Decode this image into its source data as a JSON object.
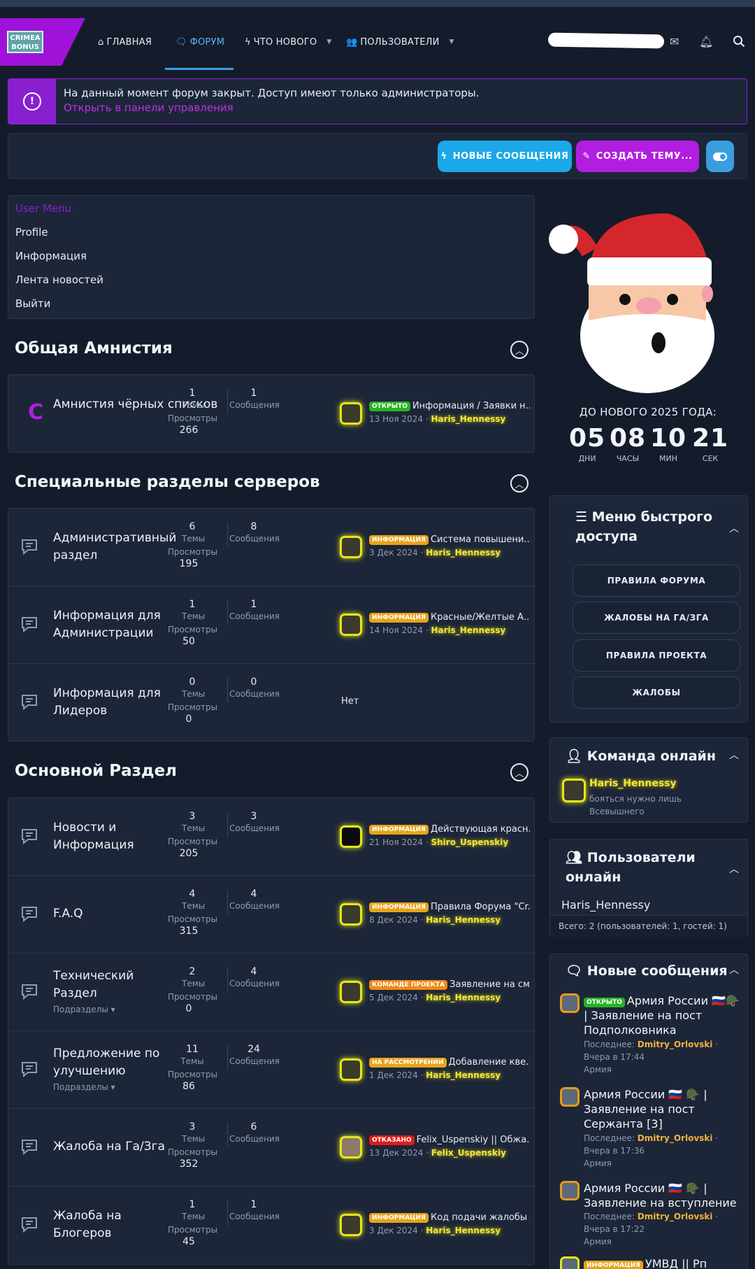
{
  "nav": {
    "logo_text": "CRIMEA BONUS",
    "items": [
      {
        "label": "ГЛАВНАЯ"
      },
      {
        "label": "ФОРУМ"
      },
      {
        "label": "ЧТО НОВОГО"
      },
      {
        "label": "ПОЛЬЗОВАТЕЛИ"
      }
    ]
  },
  "alert": {
    "text": "На данный момент форум закрыт. Доступ имеют только администраторы.",
    "link": "Открыть в панели управления"
  },
  "actions": {
    "new_posts": "НОВЫЕ СООБЩЕНИЯ",
    "create_thread": "СОЗДАТЬ ТЕМУ..."
  },
  "user_menu": {
    "title": "User Menu",
    "items": [
      "Profile",
      "Информация",
      "Лента новостей",
      "Выйти"
    ]
  },
  "labels": {
    "threads": "Темы",
    "messages": "Сообщения",
    "views": "Просмотры",
    "subforums": "Подразделы",
    "none": "Нет"
  },
  "sections": [
    {
      "title": "Общая Амнистия",
      "forums": [
        {
          "name": "Амнистия чёрных списков",
          "threads": "1",
          "messages": "1",
          "views": "266",
          "badge": "ОТКРЫТО",
          "badge_type": "open",
          "last_title": "Информация / Заявки н...",
          "date": "13 Ноя 2024",
          "user": "Haris_Hennessy"
        }
      ]
    },
    {
      "title": "Специальные разделы серверов",
      "forums": [
        {
          "name": "Административный раздел",
          "threads": "6",
          "messages": "8",
          "views": "195",
          "badge": "ИНФОРМАЦИЯ",
          "badge_type": "info",
          "last_title": "Система повышени...",
          "date": "3 Дек 2024",
          "user": "Haris_Hennessy"
        },
        {
          "name": "Информация для Администрации",
          "threads": "1",
          "messages": "1",
          "views": "50",
          "badge": "ИНФОРМАЦИЯ",
          "badge_type": "info",
          "last_title": "Красные/Желтые А...",
          "date": "14 Ноя 2024",
          "user": "Haris_Hennessy"
        },
        {
          "name": "Информация для Лидеров",
          "threads": "0",
          "messages": "0",
          "views": "0",
          "none": true
        }
      ]
    },
    {
      "title": "Основной Раздел",
      "forums": [
        {
          "name": "Новости и Информация",
          "threads": "3",
          "messages": "3",
          "views": "205",
          "badge": "ИНФОРМАЦИЯ",
          "badge_type": "info",
          "last_title": "Действующая красн...",
          "date": "21 Ноя 2024",
          "user": "Shiro_Uspenskiy"
        },
        {
          "name": "F.A.Q",
          "threads": "4",
          "messages": "4",
          "views": "315",
          "badge": "ИНФОРМАЦИЯ",
          "badge_type": "info",
          "last_title": "Правила Форума \"Cr...",
          "date": "8 Дек 2024",
          "user": "Haris_Hennessy"
        },
        {
          "name": "Технический Раздел",
          "threads": "2",
          "messages": "4",
          "views": "0",
          "badge": "КОМАНДЕ ПРОЕКТА",
          "badge_type": "team",
          "last_title": "Заявление на см...",
          "date": "5 Дек 2024",
          "user": "Haris_Hennessy",
          "sub": true
        },
        {
          "name": "Предложение по улучшению",
          "threads": "11",
          "messages": "24",
          "views": "86",
          "badge": "НА РАССМОТРЕНИИ",
          "badge_type": "review",
          "last_title": "Добавление кве...",
          "date": "1 Дек 2024",
          "user": "Haris_Hennessy",
          "sub": true
        },
        {
          "name": "Жалоба на Га/Зга",
          "threads": "3",
          "messages": "6",
          "views": "352",
          "badge": "ОТКАЗАНО",
          "badge_type": "rej",
          "last_title": "Felix_Uspenskiy || Обжа...",
          "date": "13 Дек 2024",
          "user": "Felix_Uspenskiy"
        },
        {
          "name": "Жалоба на Блогеров",
          "threads": "1",
          "messages": "1",
          "views": "45",
          "badge": "ИНФОРМАЦИЯ",
          "badge_type": "info",
          "last_title": "Код подачи жалобы ...",
          "date": "3 Дек 2024",
          "user": "Haris_Hennessy"
        }
      ]
    }
  ],
  "countdown": {
    "title": "ДО НОВОГО 2025 ГОДА:",
    "days": "05",
    "days_label": "ДНИ",
    "hours": "08",
    "hours_label": "ЧАСЫ",
    "mins": "10",
    "mins_label": "МИН",
    "secs": "21",
    "secs_label": "СЕК"
  },
  "quick_access": {
    "title": "Меню быстрого доступа",
    "items": [
      "ПРАВИЛА ФОРУМА",
      "ЖАЛОБЫ НА ГА/ЗГА",
      "ПРАВИЛА ПРОЕКТА",
      "ЖАЛОБЫ"
    ]
  },
  "team_online": {
    "title": "Команда онлайн",
    "user": "Haris_Hennessy",
    "status": "бояться нужно лишь Всевышнего"
  },
  "users_online": {
    "title": "Пользователи онлайн",
    "user": "Haris_Hennessy",
    "total": "Всего: 2 (пользователей: 1, гостей: 1)"
  },
  "new_posts": {
    "title": "Новые сообщения",
    "last_label": "Последнее:",
    "items": [
      {
        "badge": "ОТКРЫТО",
        "title": "Армия России 🇷🇺🪖 | Заявление на пост Подполковника",
        "user": "Dmitry_Orlovski",
        "time": "Вчера в 17:44",
        "forum": "Армия"
      },
      {
        "title": "Армия России 🇷🇺 🪖 | Заявление на пост Сержанта [3]",
        "user": "Dmitry_Orlovski",
        "time": "Вчера в 17:36",
        "forum": "Армия"
      },
      {
        "title": "Армия России 🇷🇺 🪖 | Заявление на вступление",
        "user": "Dmitry_Orlovski",
        "time": "Вчера в 17:22",
        "forum": "Армия"
      },
      {
        "badge": "ИНФОРМАЦИЯ",
        "title": "УМВД || Рп"
      }
    ]
  }
}
